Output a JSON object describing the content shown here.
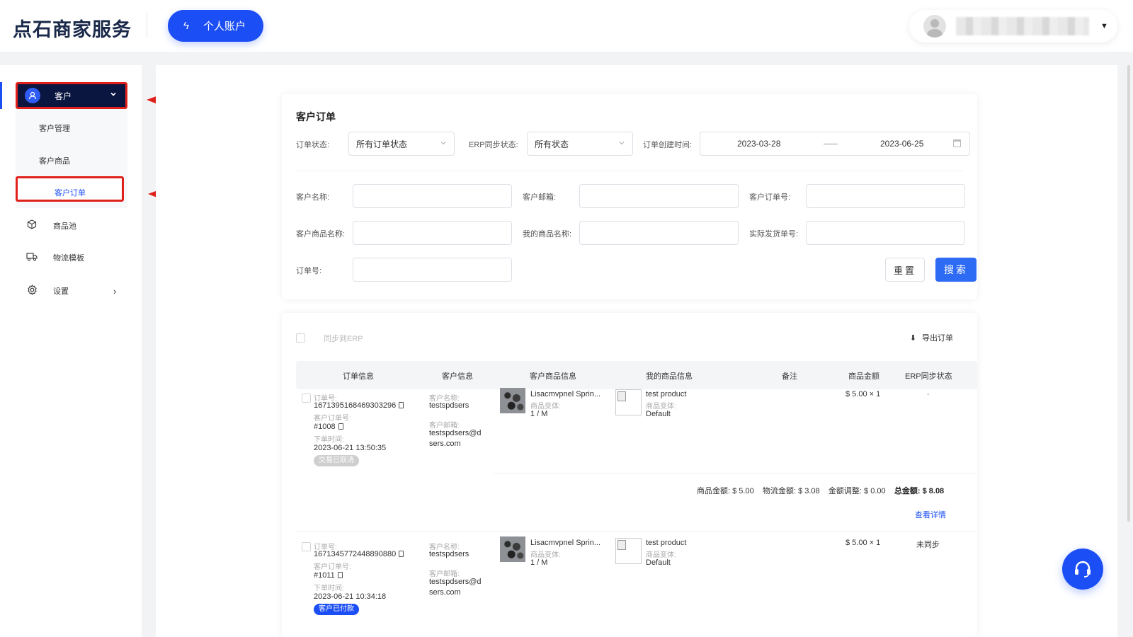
{
  "header": {
    "logo": "点石商家服务",
    "account_button": "个人账户"
  },
  "sidebar": {
    "customer": "客户",
    "sub_items": [
      "客户管理",
      "客户商品",
      "客户订单"
    ],
    "items": [
      {
        "label": "商品池",
        "icon": "cube-icon"
      },
      {
        "label": "物流模板",
        "icon": "truck-icon"
      },
      {
        "label": "设置",
        "icon": "gear-icon"
      }
    ]
  },
  "filters": {
    "title": "客户订单",
    "order_status_label": "订单状态:",
    "order_status_value": "所有订单状态",
    "erp_status_label": "ERP同步状态:",
    "erp_status_value": "所有状态",
    "created_label": "订单创建时间:",
    "date_start": "2023-03-28",
    "date_end": "2023-06-25",
    "customer_name_label": "客户名称:",
    "customer_email_label": "客户邮箱:",
    "customer_order_no_label": "客户订单号:",
    "customer_product_label": "客户商品名称:",
    "my_product_label": "我的商品名称:",
    "shipping_no_label": "实际发货单号:",
    "order_no_label": "订单号:",
    "reset": "重置",
    "search": "搜索"
  },
  "orders": {
    "sync_erp": "同步到ERP",
    "export": "导出订单",
    "columns": [
      "订单信息",
      "客户信息",
      "客户商品信息",
      "我的商品信息",
      "备注",
      "商品金额",
      "ERP同步状态"
    ],
    "labels": {
      "order_no": "订单号:",
      "customer_order_no": "客户订单号:",
      "order_time": "下单时间:",
      "customer_name": "客户名称:",
      "customer_email": "客户邮箱:",
      "variant": "商品变体:",
      "goods_amount": "商品金额:",
      "shipping_amount": "物流金额:",
      "adjust_amount": "金额调整:",
      "total_amount": "总金额:",
      "view_detail": "查看详情"
    },
    "rows": [
      {
        "order_no": "1671395168469303296",
        "customer_order_no": "#1008",
        "order_time": "2023-06-21 13:50:35",
        "status": "交易已取消",
        "customer_name": "testspdsers",
        "email_line1": "testspdsers@d",
        "email_line2": "sers.com",
        "customer_product": "Lisacmvpnel Sprin...",
        "customer_variant": "1 / M",
        "my_product": "test product",
        "my_variant": "Default",
        "price": "$ 5.00 × 1",
        "erp_status": "-",
        "goods_amount": "$ 5.00",
        "shipping_amount": "$ 3.08",
        "adjust_amount": "$ 0.00",
        "total_amount": "$ 8.08"
      },
      {
        "order_no": "1671345772448890880",
        "customer_order_no": "#1011",
        "order_time": "2023-06-21 10:34:18",
        "status": "客户已付款",
        "customer_name": "testspdsers",
        "email_line1": "testspdsers@d",
        "email_line2": "sers.com",
        "customer_product": "Lisacmvpnel Sprin...",
        "customer_variant": "1 / M",
        "my_product": "test product",
        "my_variant": "Default",
        "price": "$ 5.00 × 1",
        "erp_status": "未同步"
      }
    ]
  },
  "colors": {
    "brand_blue": "#1c4ef5",
    "highlight_red": "#e0201a",
    "sidebar_dark": "#0b1640"
  }
}
